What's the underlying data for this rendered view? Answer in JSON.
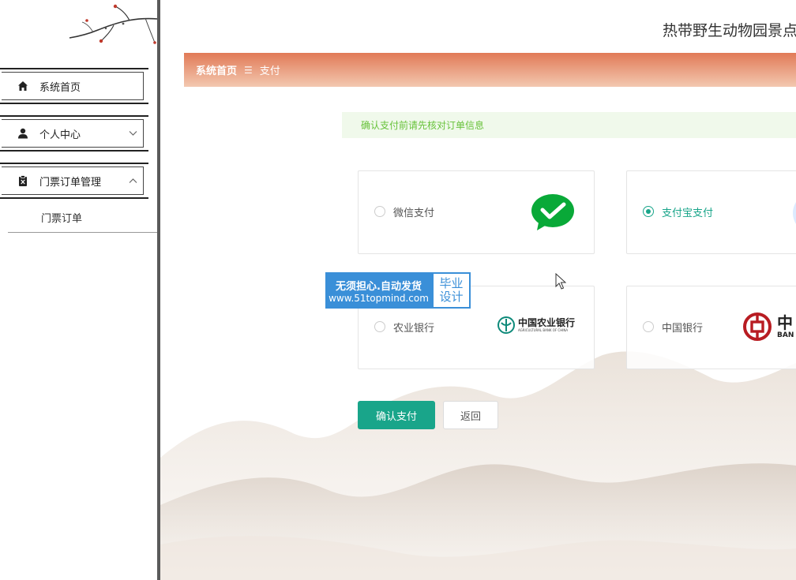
{
  "site": {
    "title": "热带野生动物园景点"
  },
  "sidebar": {
    "items": [
      {
        "label": "系统首页",
        "icon": "home-icon"
      },
      {
        "label": "个人中心",
        "icon": "user-icon"
      },
      {
        "label": "门票订单管理",
        "icon": "clipboard-icon"
      }
    ],
    "sub_items": [
      {
        "label": "门票订单"
      }
    ]
  },
  "breadcrumb": {
    "home": "系统首页",
    "separator": "☰",
    "current": "支付"
  },
  "notice": {
    "text": "确认支付前请先核对订单信息"
  },
  "payment_methods": [
    {
      "label": "微信支付",
      "selected": false,
      "logo": "wechat-pay-logo"
    },
    {
      "label": "支付宝支付",
      "selected": true,
      "logo": "alipay-logo"
    },
    {
      "label": "农业银行",
      "selected": false,
      "logo": "agricultural-bank-logo",
      "logo_text": "中国农业银行",
      "logo_subtext": "AGRICULTURAL BANK OF CHINA"
    },
    {
      "label": "中国银行",
      "selected": false,
      "logo": "bank-of-china-logo",
      "logo_text": "中",
      "logo_subtext": "BAN"
    }
  ],
  "actions": {
    "confirm_label": "确认支付",
    "back_label": "返回"
  },
  "watermark": {
    "line1": "无须担心.自动发货",
    "line2": "www.51topmind.com",
    "tag1": "毕业",
    "tag2": "设计"
  },
  "colors": {
    "accent": "#19a58a",
    "header_gradient_start": "#e17a57",
    "notice_bg": "#f0f9eb",
    "notice_text": "#67c23a",
    "watermark_blue": "#3a8fd8"
  }
}
